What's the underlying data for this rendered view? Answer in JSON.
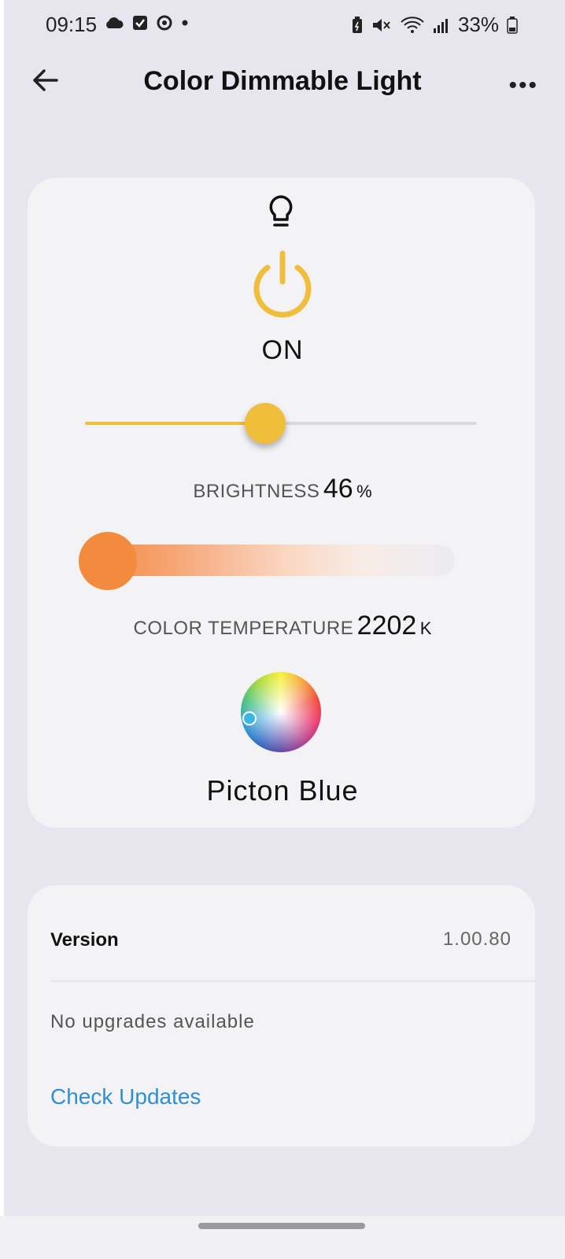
{
  "status_bar": {
    "time": "09:15",
    "battery_text": "33%",
    "left_icons": [
      "cloud-icon",
      "checkbox-icon",
      "sync-icon",
      "dot-icon"
    ],
    "right_icons": [
      "battery-saver-icon",
      "mute-icon",
      "wifi-icon",
      "signal-icon",
      "battery-icon"
    ]
  },
  "header": {
    "title": "Color Dimmable Light",
    "back_icon": "arrow-left-icon",
    "more_label": "•••"
  },
  "light": {
    "state": "ON",
    "brightness_label": "BRIGHTNESS",
    "brightness_value": "46",
    "brightness_unit": "%",
    "brightness_fraction": 0.46,
    "temperature_label": "COLOR TEMPERATURE",
    "temperature_value": "2202",
    "temperature_unit": "K",
    "color_name": "Picton Blue",
    "accent_color": "#efbe3b",
    "temperature_color": "#f38b3f",
    "selected_color": "#39b7e3"
  },
  "firmware": {
    "version_label": "Version",
    "version_value": "1.00.80",
    "status_text": "No upgrades available",
    "check_label": "Check Updates",
    "link_color": "#2f8fd6"
  }
}
